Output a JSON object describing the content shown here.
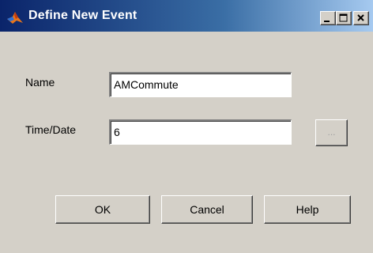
{
  "window": {
    "title": "Define New Event",
    "title_icon": "matlab-icon",
    "caption_buttons": {
      "minimize_icon": "minimize-icon",
      "maximize_icon": "maximize-icon",
      "close_icon": "close-icon"
    }
  },
  "form": {
    "name_label": "Name",
    "name_value": "AMCommute",
    "time_label": "Time/Date",
    "time_value": "6",
    "browse_label": "..."
  },
  "buttons": {
    "ok": "OK",
    "cancel": "Cancel",
    "help": "Help"
  },
  "colors": {
    "titlebar_start": "#0a246a",
    "titlebar_end": "#a6caf0",
    "face": "#d4d0c8"
  }
}
